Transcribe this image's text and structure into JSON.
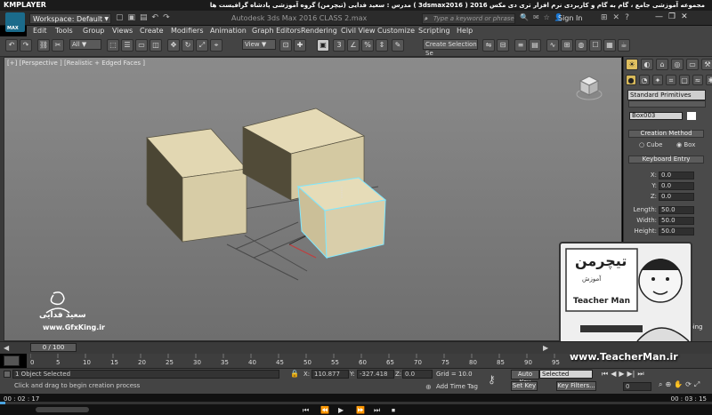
{
  "player": {
    "name": "KMPLAYER",
    "title_ar": "مجموعه آموزشی جامع ، گام به گام و کاربردی نرم افزار تری دی مکس 2016 ( 3dsmax2016 )   مدرس : سعید فدایی (تیچرمن) گروه آموزشی پادشاه گرافیست ها",
    "current_time": "00 : 02 : 17",
    "duration": "00 : 03 : 15",
    "window_buttons": [
      "▭",
      "—",
      "◻",
      "✕"
    ]
  },
  "titlebar": {
    "workspace_label": "Workspace: Default",
    "app_title": "Autodesk 3ds Max 2016      CLASS 2.max",
    "search_placeholder": "Type a keyword or phrase",
    "sign_in": "Sign In",
    "logo_text": "MAX"
  },
  "menu": [
    "Edit",
    "Tools",
    "Group",
    "Views",
    "Create",
    "Modifiers",
    "Animation",
    "Graph Editors",
    "Rendering",
    "Civil View",
    "Customize",
    "Scripting",
    "Help"
  ],
  "toolbar": {
    "selection_filter": "All",
    "ref_coord": "View",
    "named_selection_placeholder": "Create Selection Se"
  },
  "viewport": {
    "label": "[+] [Perspective ] [Realistic + Edged Faces ]",
    "colors": {
      "background_top": "#8b8b8b",
      "background_bottom": "#6e6e6e",
      "box_face": "#d9cfaa",
      "box_side": "#a59c7b",
      "selection": "#7fe8ff"
    }
  },
  "command_panel": {
    "category": "Standard Primitives",
    "object_name": "Box003",
    "creation_method": {
      "title": "Creation Method",
      "options": [
        "Cube",
        "Box"
      ],
      "selected": "Box"
    },
    "keyboard_entry": {
      "title": "Keyboard Entry",
      "fields": [
        {
          "label": "X:",
          "value": "0.0"
        },
        {
          "label": "Y:",
          "value": "0.0"
        },
        {
          "label": "Z:",
          "value": "0.0"
        },
        {
          "label": "Length:",
          "value": "50.0"
        },
        {
          "label": "Width:",
          "value": "50.0"
        },
        {
          "label": "Height:",
          "value": "50.0"
        }
      ]
    },
    "mapping": "Generate Mapping Coords."
  },
  "timeline": {
    "slider_label": "0 / 100",
    "slider_position": 0,
    "ticks": [
      "0",
      "5",
      "10",
      "15",
      "20",
      "25",
      "30",
      "35",
      "40",
      "45",
      "50",
      "55",
      "60",
      "65",
      "70",
      "75",
      "80",
      "85",
      "90",
      "95"
    ]
  },
  "statusbar": {
    "selection_info": "1 Object Selected",
    "prompt": "Click and drag to begin creation process",
    "x_label": "X:",
    "x_value": "110.877",
    "y_label": "Y:",
    "y_value": "-327.418",
    "z_label": "Z:",
    "z_value": "0.0",
    "grid": "Grid = 10.0",
    "add_time_tag": "Add Time Tag",
    "auto_key": "Auto Key",
    "set_key": "Set Key",
    "key_filter_value": "Selected",
    "key_filters": "Key Filters...",
    "frame": "0"
  },
  "overlays": {
    "author_name": "سعید فدایی",
    "author_site": "www.GfxKing.ir",
    "teacher_title": "تیچرمن",
    "teacher_sub": "آموزش",
    "teacher_en": "Teacher Man",
    "site_url": "www.TeacherMan.ir"
  },
  "player_buttons": [
    "⏮",
    "⏪",
    "▶",
    "⏩",
    "⏭",
    "⏹"
  ]
}
